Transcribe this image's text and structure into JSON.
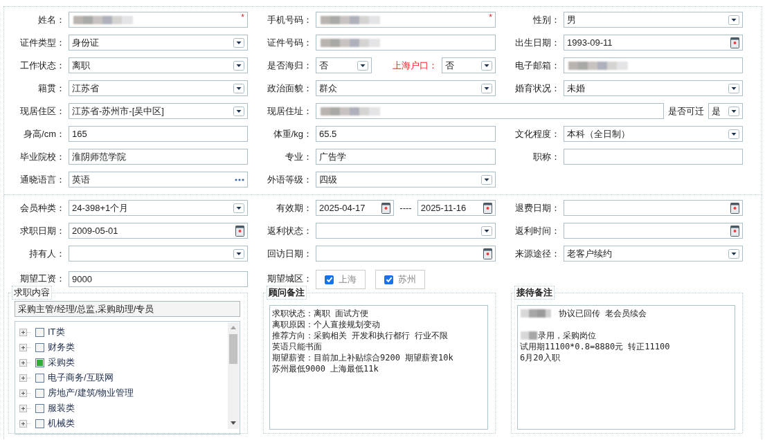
{
  "personal_section": {
    "rows": [
      {
        "cells": [
          {
            "label": "姓名：",
            "parts": [
              {
                "kind": "blurred",
                "required_mark": "*"
              }
            ]
          },
          {
            "label": "手机号码：",
            "parts": [
              {
                "kind": "blurred",
                "required_mark": "*"
              }
            ]
          },
          {
            "label": "性别：",
            "parts": [
              {
                "kind": "select",
                "value": "男"
              }
            ]
          }
        ]
      },
      {
        "cells": [
          {
            "label": "证件类型：",
            "parts": [
              {
                "kind": "select",
                "value": "身份证"
              }
            ]
          },
          {
            "label": "证件号码：",
            "parts": [
              {
                "kind": "blurred"
              }
            ]
          },
          {
            "label": "出生日期：",
            "parts": [
              {
                "kind": "date",
                "value": "1993-09-11"
              }
            ]
          }
        ]
      },
      {
        "cells": [
          {
            "label": "工作状态：",
            "parts": [
              {
                "kind": "select",
                "value": "离职"
              }
            ]
          },
          {
            "label": "是否海归：",
            "parts": [
              {
                "kind": "select",
                "value": "否"
              },
              {
                "kind": "label",
                "text": "上海户口：",
                "emphasis": true
              },
              {
                "kind": "select",
                "value": "否"
              }
            ]
          },
          {
            "label": "电子邮箱：",
            "parts": [
              {
                "kind": "blurred"
              }
            ]
          }
        ]
      },
      {
        "cells": [
          {
            "label": "籍贯：",
            "parts": [
              {
                "kind": "select",
                "value": "江苏省"
              }
            ]
          },
          {
            "label": "政治面貌：",
            "parts": [
              {
                "kind": "select",
                "value": "群众"
              }
            ]
          },
          {
            "label": "婚育状况：",
            "parts": [
              {
                "kind": "select",
                "value": "未婚"
              }
            ]
          }
        ]
      },
      {
        "cells": [
          {
            "label": "现居住区：",
            "parts": [
              {
                "kind": "select",
                "value": "江苏省-苏州市-[吴中区]"
              }
            ]
          },
          {
            "label": "现居住址：",
            "parts": [
              {
                "kind": "blurred"
              },
              {
                "kind": "label",
                "text": "是否可迁",
                "emphasis": false
              },
              {
                "kind": "select",
                "value": "是"
              }
            ]
          }
        ]
      },
      {
        "cells": [
          {
            "label": "身高/cm：",
            "parts": [
              {
                "kind": "text",
                "value": "165"
              }
            ]
          },
          {
            "label": "体重/kg：",
            "parts": [
              {
                "kind": "text",
                "value": "65.5"
              }
            ]
          },
          {
            "label": "文化程度：",
            "parts": [
              {
                "kind": "select",
                "value": "本科（全日制）"
              }
            ]
          }
        ]
      },
      {
        "cells": [
          {
            "label": "毕业院校：",
            "parts": [
              {
                "kind": "text",
                "value": "淮阴师范学院"
              }
            ]
          },
          {
            "label": "专业：",
            "parts": [
              {
                "kind": "text",
                "value": "广告学"
              }
            ]
          },
          {
            "label": "职称：",
            "parts": [
              {
                "kind": "text"
              }
            ]
          }
        ]
      },
      {
        "cells": [
          {
            "label": "通晓语言：",
            "parts": [
              {
                "kind": "more",
                "value": "英语"
              }
            ]
          },
          {
            "label": "外语等级：",
            "parts": [
              {
                "kind": "select",
                "value": "四级"
              }
            ]
          }
        ]
      }
    ]
  },
  "membership_section": {
    "rows": [
      {
        "cells": [
          {
            "label": "会员种类：",
            "parts": [
              {
                "kind": "select",
                "value": "24-398+1个月"
              }
            ]
          },
          {
            "label": "有效期：",
            "parts": [
              {
                "kind": "date",
                "value": "2025-04-17"
              },
              {
                "kind": "separator",
                "text": "----"
              },
              {
                "kind": "date",
                "value": "2025-11-16"
              }
            ]
          },
          {
            "label": "退费日期：",
            "parts": [
              {
                "kind": "date"
              }
            ]
          }
        ]
      },
      {
        "cells": [
          {
            "label": "求职日期：",
            "parts": [
              {
                "kind": "date",
                "value": "2009-05-01"
              }
            ]
          },
          {
            "label": "返利状态：",
            "parts": [
              {
                "kind": "select"
              }
            ]
          },
          {
            "label": "返利时间：",
            "parts": [
              {
                "kind": "date"
              }
            ]
          }
        ]
      },
      {
        "cells": [
          {
            "label": "持有人：",
            "parts": [
              {
                "kind": "select"
              }
            ]
          },
          {
            "label": "回访日期：",
            "parts": [
              {
                "kind": "date"
              }
            ]
          },
          {
            "label": "来源途径：",
            "parts": [
              {
                "kind": "select",
                "value": "老客户续约"
              }
            ]
          }
        ]
      },
      {
        "cells": [
          {
            "label": "期望工资：",
            "parts": [
              {
                "kind": "text",
                "value": "9000"
              }
            ]
          },
          {
            "label": "期望城区：",
            "parts": [
              {
                "kind": "checkbox",
                "text": "上海",
                "checked": true
              },
              {
                "kind": "checkbox",
                "text": "苏州",
                "checked": true
              }
            ]
          }
        ]
      }
    ]
  },
  "job_content": {
    "title": "求职内容",
    "summary": "采购主管/经理/总监,采购助理/专员",
    "categories": [
      {
        "label": "IT类",
        "checked": false
      },
      {
        "label": "财务类",
        "checked": false
      },
      {
        "label": "采购类",
        "checked": true
      },
      {
        "label": "电子商务/互联网",
        "checked": false
      },
      {
        "label": "房地产/建筑/物业管理",
        "checked": false
      },
      {
        "label": "服装类",
        "checked": false
      },
      {
        "label": "机械类",
        "checked": false
      }
    ]
  },
  "advisor_notes": {
    "title": "顾问备注",
    "lines": [
      "求职状态：离职 面试方便",
      "离职原因：个人直接规划变动",
      "推荐方向：采购相关  开发和执行都行 行业不限",
      "英语只能书面",
      "期望薪资：目前加上补贴综合9200 期望薪资10k",
      "苏州最低9000  上海最低11k"
    ]
  },
  "reception_notes": {
    "title": "接待备注",
    "paragraphs": [
      [
        {
          "redacted_prefix": true,
          "text": "协议已回传 老会员续会"
        }
      ],
      [
        {
          "redacted_prefix": true,
          "text": "录用，采购岗位"
        },
        {
          "redacted_prefix": false,
          "text": "试用期11100*0.8=8880元 转正11100"
        },
        {
          "redacted_prefix": false,
          "text": "6月20入职"
        }
      ]
    ]
  }
}
